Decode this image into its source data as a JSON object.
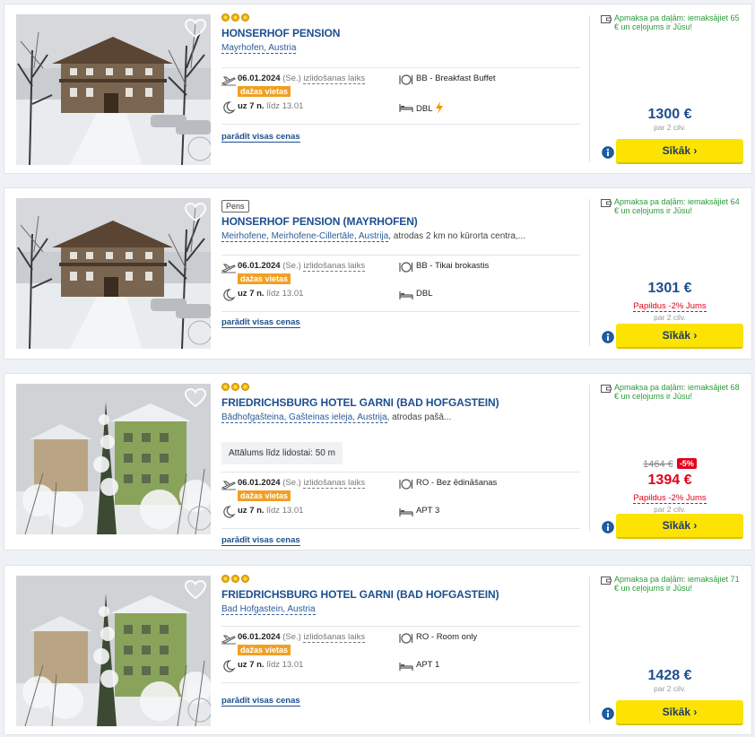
{
  "results": [
    {
      "stars": 3,
      "badge": "",
      "name": "HONSERHOF PENSION",
      "location": "Mayrhofen, Austria",
      "location_extra": "",
      "airport_distance": "",
      "date": "06.01.2024",
      "weekday": "(Se.)",
      "departure_label": "izlidošanas laiks",
      "availability": "dažas vietas",
      "nights": "uz 7 n.",
      "until": "līdz 13.01",
      "meal": "BB - Breakfast Buffet",
      "room": "DBL",
      "room_flash": true,
      "all_prices": "parādīt visas cenas",
      "payment_note": "Apmaksa pa daļām: iemaksājiet 65 € un ceļojums ir Jūsu!",
      "old_price": "",
      "discount": "",
      "price": "1300 €",
      "price_red": false,
      "extra_discount": "",
      "per_people": "par 2 cilv.",
      "button": "Sīkāk ›",
      "photo": "pension-snow"
    },
    {
      "stars": 0,
      "badge": "Pens",
      "name": "HONSERHOF PENSION (MAYRHOFEN)",
      "location": "Meirhofene, Meirhofene-Cillertāle, Austrija",
      "location_extra": ", atrodas 2 km no kūrorta centra,...",
      "airport_distance": "",
      "date": "06.01.2024",
      "weekday": "(Se.)",
      "departure_label": "izlidošanas laiks",
      "availability": "dažas vietas",
      "nights": "uz 7 n.",
      "until": "līdz 13.01",
      "meal": "BB - Tikai brokastis",
      "room": "DBL",
      "room_flash": false,
      "all_prices": "parādīt visas cenas",
      "payment_note": "Apmaksa pa daļām: iemaksājiet 64 € un ceļojums ir Jūsu!",
      "old_price": "",
      "discount": "",
      "price": "1301 €",
      "price_red": false,
      "extra_discount": "Papildus -2% Jums",
      "per_people": "par 2 cilv.",
      "button": "Sīkāk ›",
      "photo": "pension-snow"
    },
    {
      "stars": 3,
      "badge": "",
      "name": "FRIEDRICHSBURG HOTEL GARNI (BAD HOFGASTEIN)",
      "location": "Bādhofgašteina, Gašteinas ieleja, Austrija",
      "location_extra": ", atrodas pašā...",
      "airport_distance": "Attālums līdz lidostai: 50 m",
      "date": "06.01.2024",
      "weekday": "(Se.)",
      "departure_label": "izlidošanas laiks",
      "availability": "dažas vietas",
      "nights": "uz 7 n.",
      "until": "līdz 13.01",
      "meal": "RO - Bez ēdināšanas",
      "room": "APT 3",
      "room_flash": false,
      "all_prices": "parādīt visas cenas",
      "payment_note": "Apmaksa pa daļām: iemaksājiet 68 € un ceļojums ir Jūsu!",
      "old_price": "1464 €",
      "discount": "-5%",
      "price": "1394 €",
      "price_red": true,
      "extra_discount": "Papildus -2% Jums",
      "per_people": "par 2 cilv.",
      "button": "Sīkāk ›",
      "photo": "hotel-snow"
    },
    {
      "stars": 3,
      "badge": "",
      "name": "FRIEDRICHSBURG HOTEL GARNI (BAD HOFGASTEIN)",
      "location": "Bad Hofgastein, Austria",
      "location_extra": "",
      "airport_distance": "",
      "date": "06.01.2024",
      "weekday": "(Se.)",
      "departure_label": "izlidošanas laiks",
      "availability": "dažas vietas",
      "nights": "uz 7 n.",
      "until": "līdz 13.01",
      "meal": "RO - Room only",
      "room": "APT 1",
      "room_flash": false,
      "all_prices": "parādīt visas cenas",
      "payment_note": "Apmaksa pa daļām: iemaksājiet 71 € un ceļojums ir Jūsu!",
      "old_price": "",
      "discount": "",
      "price": "1428 €",
      "price_red": false,
      "extra_discount": "",
      "per_people": "par 2 cilv.",
      "button": "Sīkāk ›",
      "photo": "hotel-snow"
    }
  ],
  "colors": {
    "brand_blue": "#1d4e8f",
    "button_yellow": "#fce302",
    "availability_orange": "#f0a022",
    "discount_red": "#e3001b",
    "payment_green": "#2a9a3a"
  }
}
